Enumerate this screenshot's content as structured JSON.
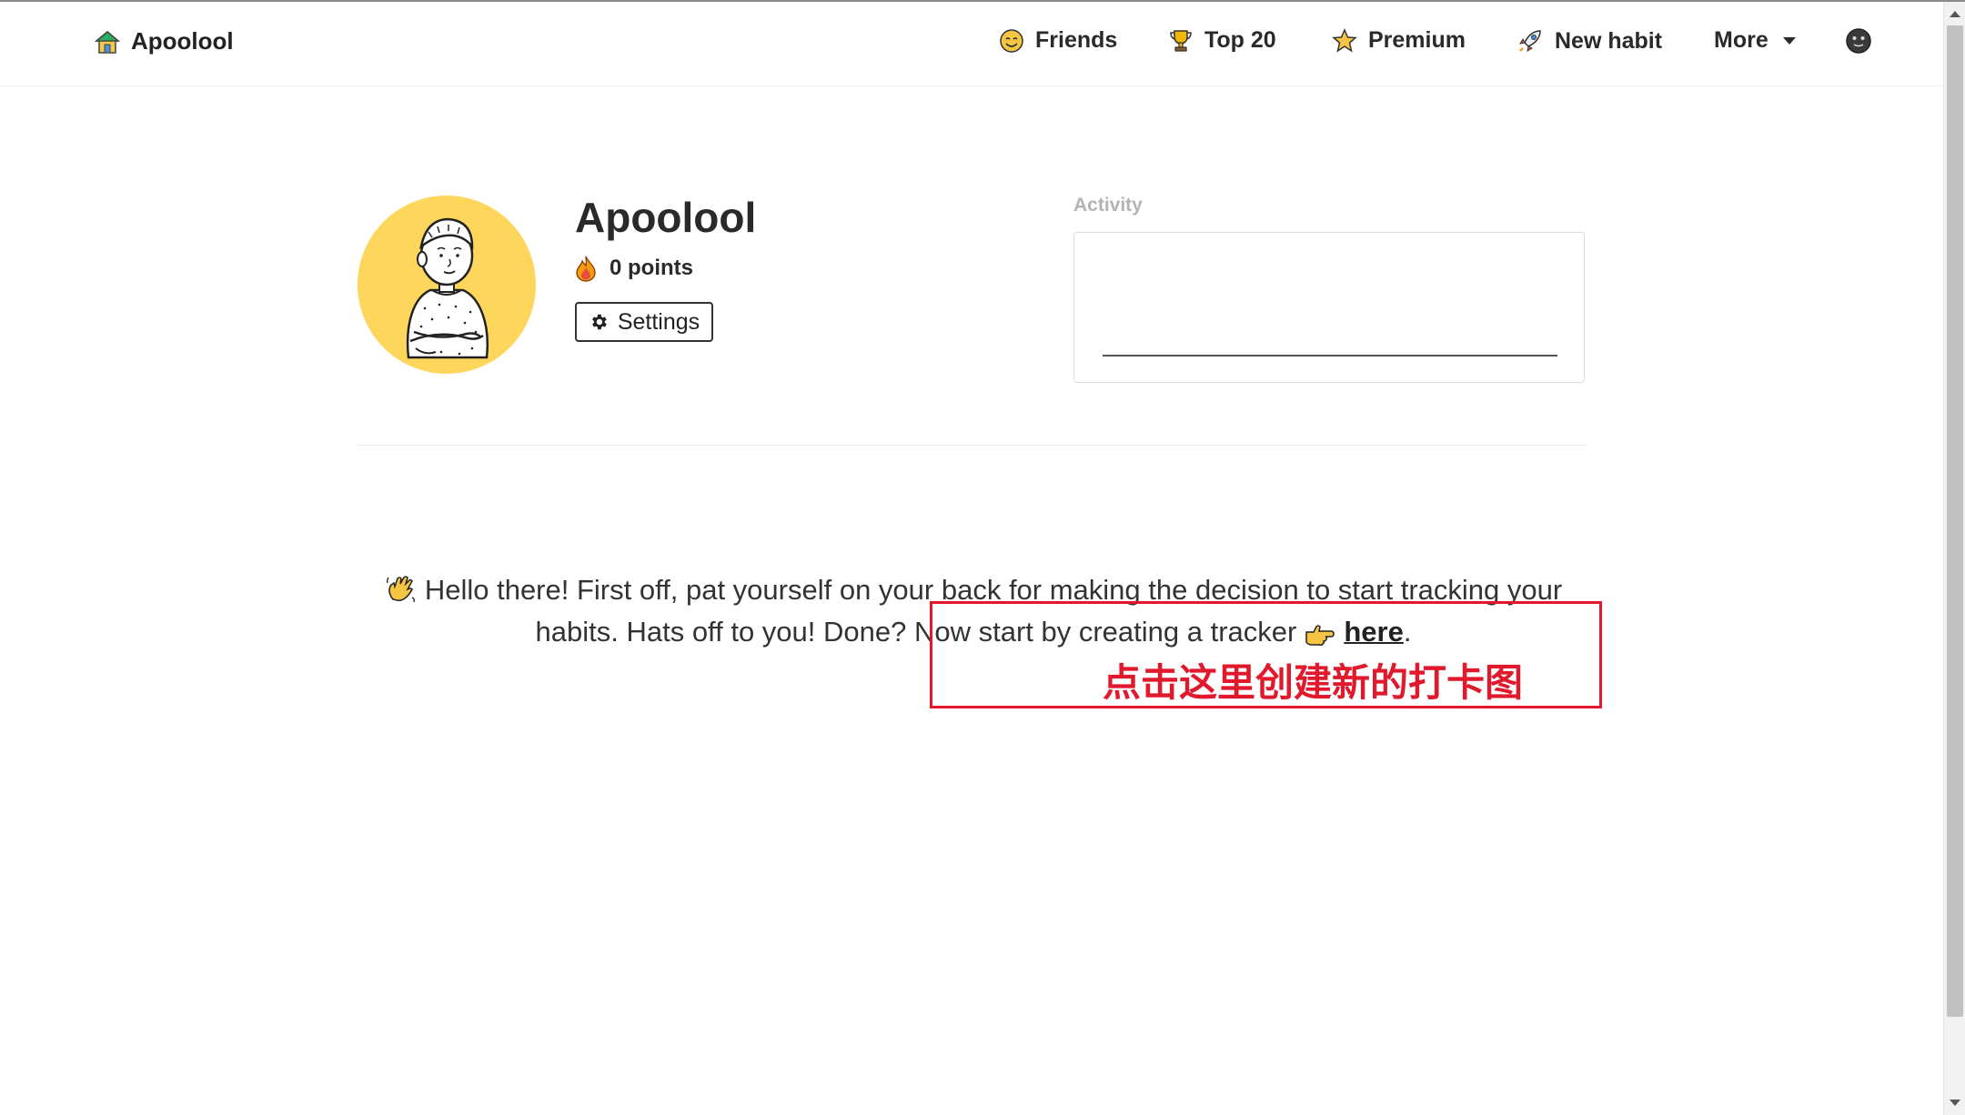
{
  "navbar": {
    "brand": "Apoolool",
    "items": [
      {
        "label": "Friends",
        "icon": "smile-icon"
      },
      {
        "label": "Top 20",
        "icon": "trophy-icon"
      },
      {
        "label": "Premium",
        "icon": "star-icon"
      },
      {
        "label": "New habit",
        "icon": "rocket-icon"
      },
      {
        "label": "More",
        "icon": "caret-down-icon"
      }
    ],
    "profile_icon": "dark-face-icon"
  },
  "profile": {
    "username": "Apoolool",
    "points": "0 points",
    "settings_label": "Settings"
  },
  "activity": {
    "label": "Activity"
  },
  "message": {
    "text_before": "Hello there! First off, pat yourself on your back for making the decision to start tracking your habits. Hats off to you! Done? Now start by creating a tracker",
    "link_label": "here",
    "text_after": "."
  },
  "annotation": {
    "text": "点击这里创建新的打卡图",
    "color": "#e0192c"
  },
  "colors": {
    "avatar_bg": "#ffd65c",
    "annotation": "#e0192c"
  }
}
